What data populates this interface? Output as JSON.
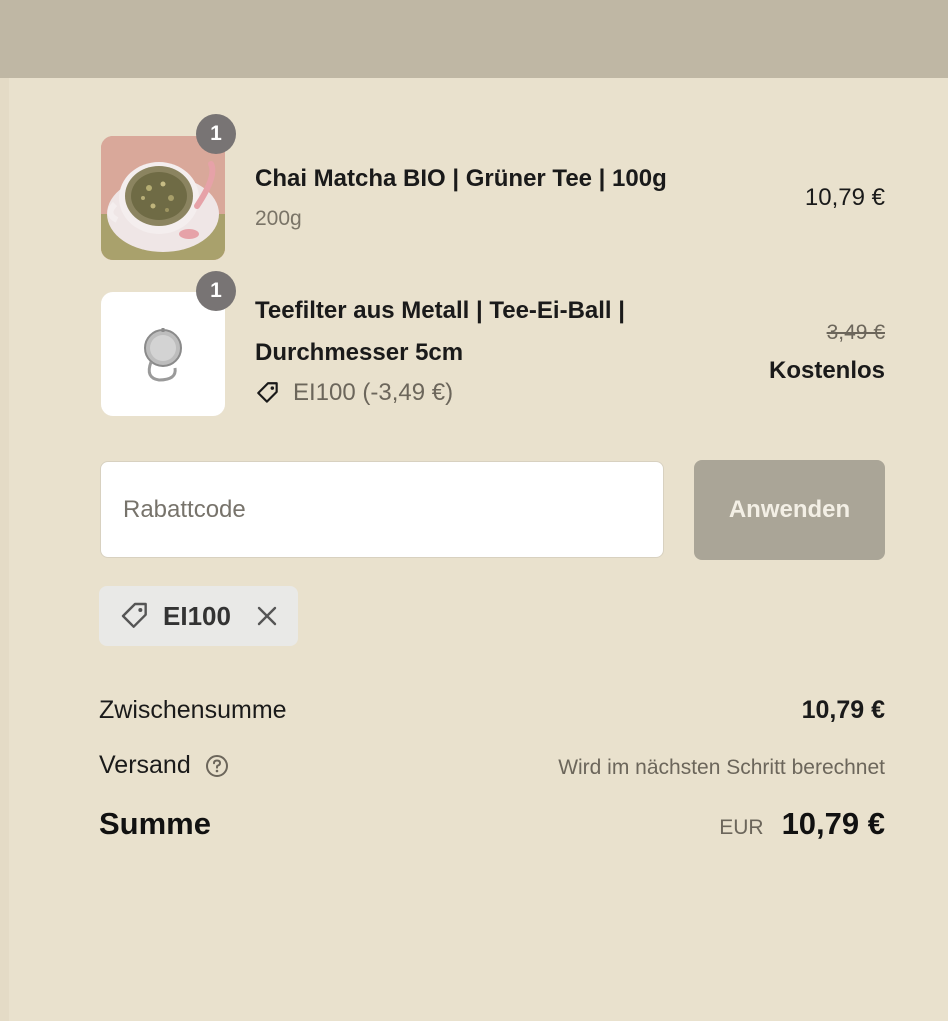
{
  "items": [
    {
      "quantity": "1",
      "title": "Chai Matcha BIO | Grüner Tee | 100g",
      "variant": "200g",
      "price": "10,79 €",
      "image_icon": "tea-cup-image"
    },
    {
      "quantity": "1",
      "title_line1": "Teefilter aus Metall | Tee-Ei-Ball |",
      "title_line2": "Durchmesser 5cm",
      "discount": "EI100 (-3,49 €)",
      "price_original": "3,49 €",
      "price": "Kostenlos",
      "image_icon": "tea-infuser-image"
    }
  ],
  "discount_form": {
    "placeholder": "Rabattcode",
    "apply_label": "Anwenden"
  },
  "applied_code": {
    "label": "EI100",
    "icon": "tag-icon"
  },
  "summary": {
    "subtotal_label": "Zwischensumme",
    "subtotal_value": "10,79 €",
    "shipping_label": "Versand",
    "shipping_value": "Wird im nächsten Schritt berechnet",
    "total_label": "Summe",
    "total_currency": "EUR",
    "total_value": "10,79 €"
  },
  "colors": {
    "background": "#e9e1cd",
    "topbar": "#bfb7a4",
    "badge": "#787474",
    "apply_button": "#aaa597",
    "chip": "#e9e9e7"
  }
}
